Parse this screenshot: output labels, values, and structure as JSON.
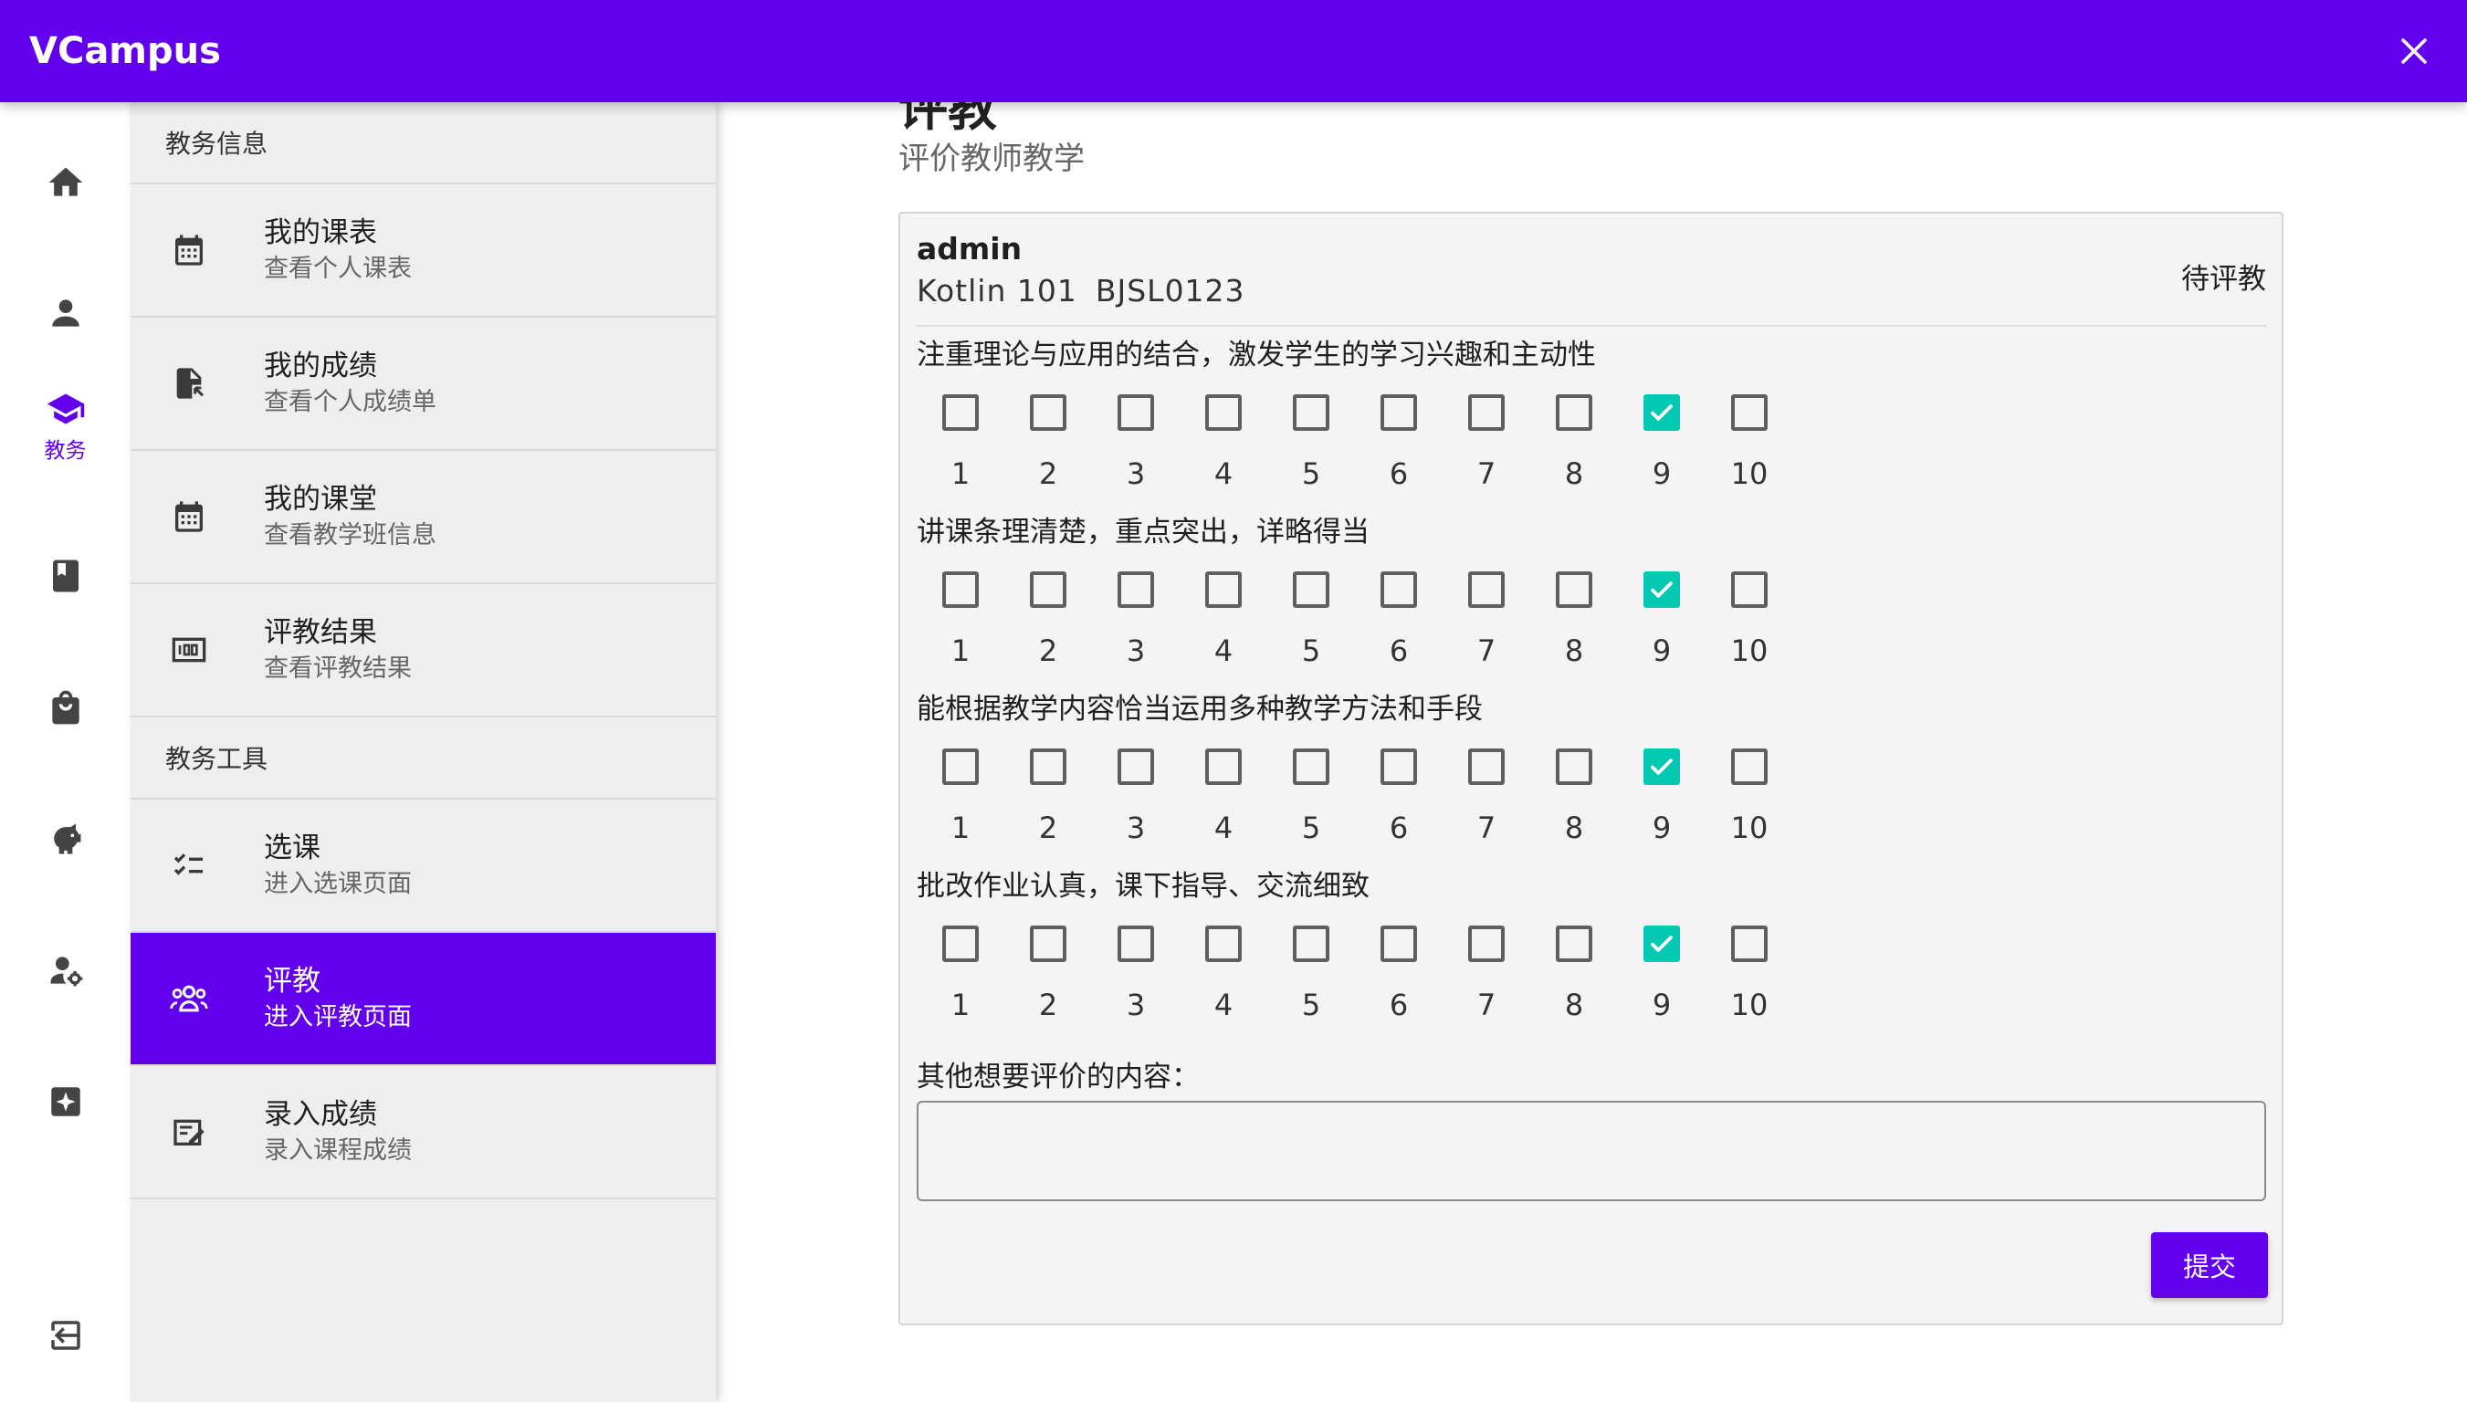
{
  "app": {
    "title": "VCampus"
  },
  "rail": {
    "active_label": "教务"
  },
  "panel": {
    "section1": "教务信息",
    "section2": "教务工具",
    "items": [
      {
        "title": "我的课表",
        "subtitle": "查看个人课表"
      },
      {
        "title": "我的成绩",
        "subtitle": "查看个人成绩单"
      },
      {
        "title": "我的课堂",
        "subtitle": "查看教学班信息"
      },
      {
        "title": "评教结果",
        "subtitle": "查看评教结果"
      },
      {
        "title": "选课",
        "subtitle": "进入选课页面"
      },
      {
        "title": "评教",
        "subtitle": "进入评教页面"
      },
      {
        "title": "录入成绩",
        "subtitle": "录入课程成绩"
      }
    ]
  },
  "main": {
    "title": "评教",
    "subtitle": "评价教师教学",
    "card": {
      "user": "admin",
      "course_name": "Kotlin 101",
      "course_code": "BJSL0123",
      "status": "待评教",
      "questions": [
        {
          "text": "注重理论与应用的结合，激发学生的学习兴趣和主动性",
          "selected": 9
        },
        {
          "text": "讲课条理清楚，重点突出，详略得当",
          "selected": 9
        },
        {
          "text": "能根据教学内容恰当运用多种教学方法和手段",
          "selected": 9
        },
        {
          "text": "批改作业认真，课下指导、交流细致",
          "selected": 9
        }
      ],
      "scores": [
        "1",
        "2",
        "3",
        "4",
        "5",
        "6",
        "7",
        "8",
        "9",
        "10"
      ],
      "other_label": "其他想要评价的内容：",
      "other_value": "",
      "submit_label": "提交"
    }
  },
  "colors": {
    "primary": "#6200ee",
    "checked": "#03c9b3"
  }
}
